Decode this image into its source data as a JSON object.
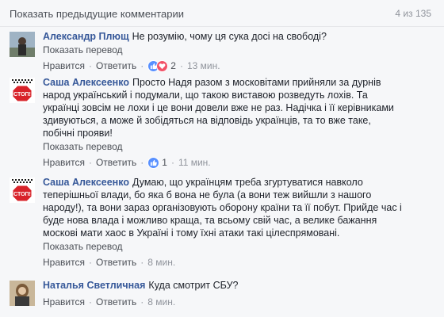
{
  "header": {
    "show_previous": "Показать предыдущие комментарии",
    "counter": "4 из 135"
  },
  "comments": [
    {
      "author": "Александр Плющ",
      "lines": [
        "Не розумію, чому ця сука досі на свободі?"
      ],
      "translate": "Показать перевод",
      "like": "Нравится",
      "reply": "Ответить",
      "reactions_count": "2",
      "time": "13 мин."
    },
    {
      "author": "Саша Алексеенко",
      "lines": [
        "Просто Надя разом з московітами прийняли за дурнів",
        "народ український і подумали, що такою виставою розведуть лохів. Та",
        "українці зовсім не лохи і це вони довели вже не раз. Надічка і її керівниками",
        "здивуються, а може й зобідяться на відповідь українців, та то вже таке,",
        "побічні прояви!"
      ],
      "translate": "Показать перевод",
      "like": "Нравится",
      "reply": "Ответить",
      "reactions_count": "1",
      "time": "11 мин."
    },
    {
      "author": "Саша Алексеенко",
      "lines": [
        "Думаю, що українцям треба згуртуватися навколо",
        "теперішньої влади, бо яка б вона не була (а вони теж вийшли з нашого",
        "народу!), та вони зараз організовують оборону країни та її побут. Прийде час і",
        "буде нова влада і можливо краща, та всьому свій час, а велике бажання",
        "москові мати хаос в Україні і тому їхні атаки такі цілеспрямовані."
      ],
      "translate": "Показать перевод",
      "like": "Нравится",
      "reply": "Ответить",
      "time": "8 мин."
    },
    {
      "author": "Наталья Светличная",
      "lines": [
        "Куда смотрит СБУ?"
      ],
      "like": "Нравится",
      "reply": "Ответить",
      "time": "8 мин."
    }
  ],
  "avatar_stop_text": "СТОП!",
  "colors": {
    "link": "#365899",
    "like_reaction": "#5890ff",
    "love_reaction": "#f25268",
    "stop_sign": "#d8232a"
  },
  "icons": {
    "like_reaction": "thumbs-up-icon",
    "love_reaction": "heart-icon"
  }
}
